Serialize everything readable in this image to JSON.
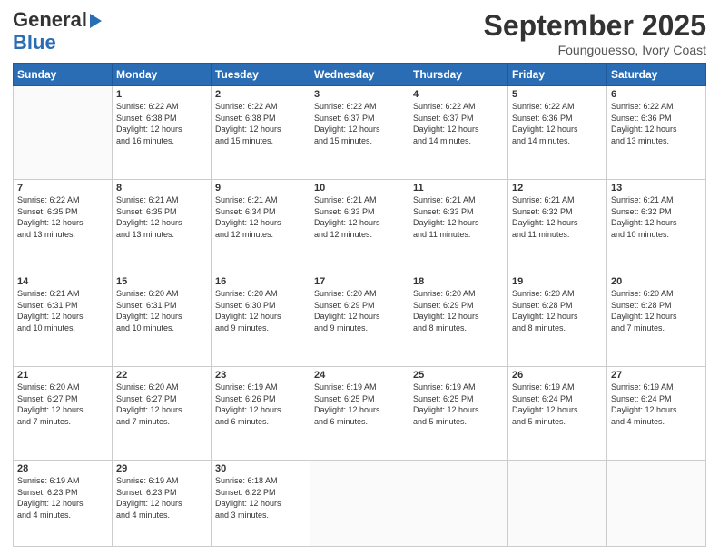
{
  "logo": {
    "line1": "General",
    "line2": "Blue"
  },
  "header": {
    "month": "September 2025",
    "location": "Foungouesso, Ivory Coast"
  },
  "weekdays": [
    "Sunday",
    "Monday",
    "Tuesday",
    "Wednesday",
    "Thursday",
    "Friday",
    "Saturday"
  ],
  "weeks": [
    [
      {
        "day": "",
        "info": ""
      },
      {
        "day": "1",
        "info": "Sunrise: 6:22 AM\nSunset: 6:38 PM\nDaylight: 12 hours\nand 16 minutes."
      },
      {
        "day": "2",
        "info": "Sunrise: 6:22 AM\nSunset: 6:38 PM\nDaylight: 12 hours\nand 15 minutes."
      },
      {
        "day": "3",
        "info": "Sunrise: 6:22 AM\nSunset: 6:37 PM\nDaylight: 12 hours\nand 15 minutes."
      },
      {
        "day": "4",
        "info": "Sunrise: 6:22 AM\nSunset: 6:37 PM\nDaylight: 12 hours\nand 14 minutes."
      },
      {
        "day": "5",
        "info": "Sunrise: 6:22 AM\nSunset: 6:36 PM\nDaylight: 12 hours\nand 14 minutes."
      },
      {
        "day": "6",
        "info": "Sunrise: 6:22 AM\nSunset: 6:36 PM\nDaylight: 12 hours\nand 13 minutes."
      }
    ],
    [
      {
        "day": "7",
        "info": "Sunrise: 6:22 AM\nSunset: 6:35 PM\nDaylight: 12 hours\nand 13 minutes."
      },
      {
        "day": "8",
        "info": "Sunrise: 6:21 AM\nSunset: 6:35 PM\nDaylight: 12 hours\nand 13 minutes."
      },
      {
        "day": "9",
        "info": "Sunrise: 6:21 AM\nSunset: 6:34 PM\nDaylight: 12 hours\nand 12 minutes."
      },
      {
        "day": "10",
        "info": "Sunrise: 6:21 AM\nSunset: 6:33 PM\nDaylight: 12 hours\nand 12 minutes."
      },
      {
        "day": "11",
        "info": "Sunrise: 6:21 AM\nSunset: 6:33 PM\nDaylight: 12 hours\nand 11 minutes."
      },
      {
        "day": "12",
        "info": "Sunrise: 6:21 AM\nSunset: 6:32 PM\nDaylight: 12 hours\nand 11 minutes."
      },
      {
        "day": "13",
        "info": "Sunrise: 6:21 AM\nSunset: 6:32 PM\nDaylight: 12 hours\nand 10 minutes."
      }
    ],
    [
      {
        "day": "14",
        "info": "Sunrise: 6:21 AM\nSunset: 6:31 PM\nDaylight: 12 hours\nand 10 minutes."
      },
      {
        "day": "15",
        "info": "Sunrise: 6:20 AM\nSunset: 6:31 PM\nDaylight: 12 hours\nand 10 minutes."
      },
      {
        "day": "16",
        "info": "Sunrise: 6:20 AM\nSunset: 6:30 PM\nDaylight: 12 hours\nand 9 minutes."
      },
      {
        "day": "17",
        "info": "Sunrise: 6:20 AM\nSunset: 6:29 PM\nDaylight: 12 hours\nand 9 minutes."
      },
      {
        "day": "18",
        "info": "Sunrise: 6:20 AM\nSunset: 6:29 PM\nDaylight: 12 hours\nand 8 minutes."
      },
      {
        "day": "19",
        "info": "Sunrise: 6:20 AM\nSunset: 6:28 PM\nDaylight: 12 hours\nand 8 minutes."
      },
      {
        "day": "20",
        "info": "Sunrise: 6:20 AM\nSunset: 6:28 PM\nDaylight: 12 hours\nand 7 minutes."
      }
    ],
    [
      {
        "day": "21",
        "info": "Sunrise: 6:20 AM\nSunset: 6:27 PM\nDaylight: 12 hours\nand 7 minutes."
      },
      {
        "day": "22",
        "info": "Sunrise: 6:20 AM\nSunset: 6:27 PM\nDaylight: 12 hours\nand 7 minutes."
      },
      {
        "day": "23",
        "info": "Sunrise: 6:19 AM\nSunset: 6:26 PM\nDaylight: 12 hours\nand 6 minutes."
      },
      {
        "day": "24",
        "info": "Sunrise: 6:19 AM\nSunset: 6:25 PM\nDaylight: 12 hours\nand 6 minutes."
      },
      {
        "day": "25",
        "info": "Sunrise: 6:19 AM\nSunset: 6:25 PM\nDaylight: 12 hours\nand 5 minutes."
      },
      {
        "day": "26",
        "info": "Sunrise: 6:19 AM\nSunset: 6:24 PM\nDaylight: 12 hours\nand 5 minutes."
      },
      {
        "day": "27",
        "info": "Sunrise: 6:19 AM\nSunset: 6:24 PM\nDaylight: 12 hours\nand 4 minutes."
      }
    ],
    [
      {
        "day": "28",
        "info": "Sunrise: 6:19 AM\nSunset: 6:23 PM\nDaylight: 12 hours\nand 4 minutes."
      },
      {
        "day": "29",
        "info": "Sunrise: 6:19 AM\nSunset: 6:23 PM\nDaylight: 12 hours\nand 4 minutes."
      },
      {
        "day": "30",
        "info": "Sunrise: 6:18 AM\nSunset: 6:22 PM\nDaylight: 12 hours\nand 3 minutes."
      },
      {
        "day": "",
        "info": ""
      },
      {
        "day": "",
        "info": ""
      },
      {
        "day": "",
        "info": ""
      },
      {
        "day": "",
        "info": ""
      }
    ]
  ]
}
